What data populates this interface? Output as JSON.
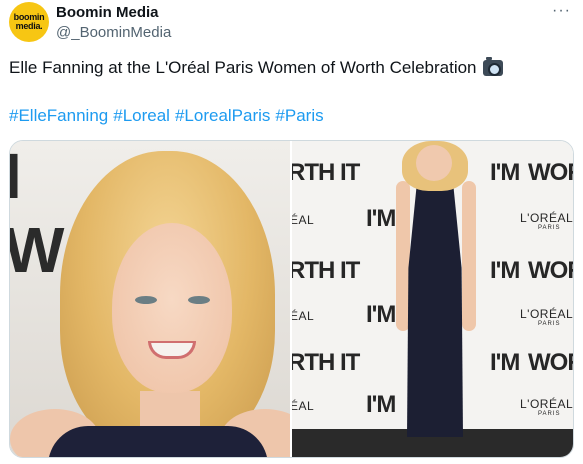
{
  "account": {
    "avatar_line1": "boomin",
    "avatar_line2": "media.",
    "name": "Boomin Media",
    "handle": "@_BoominMedia",
    "more_label": "···"
  },
  "post": {
    "text": "Elle Fanning at the L'Oréal Paris Women of Worth Celebration",
    "emoji_icon": "camera-with-flash-icon",
    "hashtags": [
      "#ElleFanning",
      "#Loreal",
      "#LorealParis",
      "#Paris"
    ]
  },
  "media": {
    "left_backdrop_text": "I WORTH",
    "right_backdrop": {
      "worth_it": "I'M WORTH IT",
      "worth_it_cut": "RTH IT",
      "im": "I'M",
      "loreal": "L'ORÉAL",
      "loreal_cut": "ÉAL",
      "paris": "PARIS"
    }
  },
  "colors": {
    "link": "#1d9bf0",
    "secondary_text": "#536471",
    "avatar_bg": "#f7c613"
  }
}
